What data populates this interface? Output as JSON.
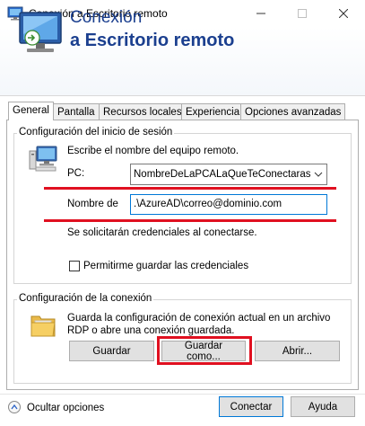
{
  "window": {
    "title": "Conexión a Escritorio remoto"
  },
  "banner": {
    "line1": "Conexión",
    "line2": "a Escritorio remoto"
  },
  "tabs": [
    {
      "label": "General",
      "active": true
    },
    {
      "label": "Pantalla",
      "active": false
    },
    {
      "label": "Recursos locales",
      "active": false
    },
    {
      "label": "Experiencia",
      "active": false
    },
    {
      "label": "Opciones avanzadas",
      "active": false
    }
  ],
  "login": {
    "group_title": "Configuración del inicio de sesión",
    "prompt": "Escribe el nombre del equipo remoto.",
    "pc_label": "PC:",
    "pc_value": "NombreDeLaPCALaQueTeConectaras",
    "user_label": "Nombre de",
    "user_value": ".\\AzureAD\\correo@dominio.com",
    "hint": "Se solicitarán credenciales al conectarse.",
    "save_credentials_label": "Permitirme guardar las credenciales",
    "save_credentials_checked": false
  },
  "connection": {
    "group_title": "Configuración de la conexión",
    "description": "Guarda la configuración de conexión actual en un archivo RDP o abre una conexión guardada.",
    "save_label": "Guardar",
    "save_as_label": "Guardar como...",
    "open_label": "Abrir..."
  },
  "footer": {
    "hide_options_label": "Ocultar opciones",
    "connect_label": "Conectar",
    "help_label": "Ayuda"
  },
  "colors": {
    "brand": "#1b3f8f",
    "annotation": "#e01020",
    "focus": "#0078d7"
  },
  "icons": [
    "remote-desktop-icon",
    "computer-icon",
    "folder-icon",
    "chevron-up-icon",
    "chevron-down-icon"
  ]
}
